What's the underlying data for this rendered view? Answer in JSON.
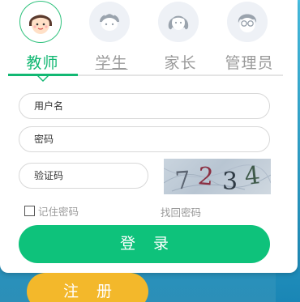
{
  "roles": [
    {
      "label": "教师",
      "icon": "teacher-avatar-icon",
      "active": true
    },
    {
      "label": "学生",
      "icon": "student-avatar-icon",
      "active": false
    },
    {
      "label": "家长",
      "icon": "parent-avatar-icon",
      "active": false
    },
    {
      "label": "管理员",
      "icon": "admin-avatar-icon",
      "active": false
    }
  ],
  "form": {
    "username_placeholder": "用户名",
    "password_placeholder": "密码",
    "captcha_placeholder": "验证码",
    "captcha_text": "7234",
    "remember_label": "记住密码",
    "remember_checked": false,
    "forgot_label": "找回密码",
    "login_label": "登录",
    "register_label": "注册"
  },
  "colors": {
    "accent": "#12b873",
    "login_button": "#0ec27b",
    "register_button": "#f3b82b",
    "background": "#1f93c2"
  }
}
